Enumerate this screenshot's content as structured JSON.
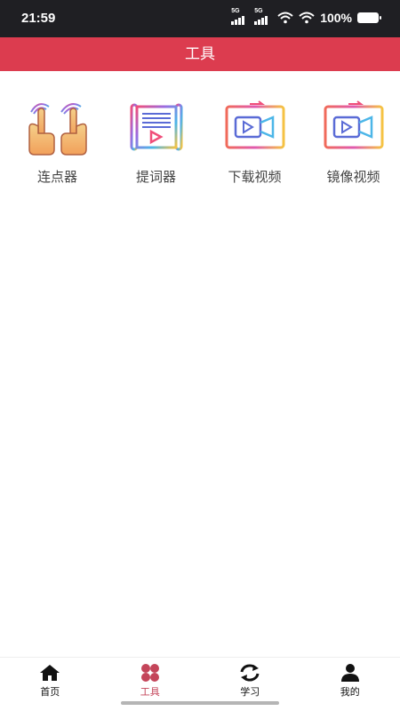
{
  "status_bar": {
    "time": "21:59",
    "network1": "5G",
    "network2": "5G",
    "battery": "100%"
  },
  "header": {
    "title": "工具"
  },
  "tools": [
    {
      "label": "连点器",
      "icon": "auto-clicker-hands-icon"
    },
    {
      "label": "提词器",
      "icon": "teleprompter-icon"
    },
    {
      "label": "下载视频",
      "icon": "download-video-icon"
    },
    {
      "label": "镜像视频",
      "icon": "mirror-video-icon"
    }
  ],
  "tabbar": {
    "items": [
      {
        "label": "首页",
        "icon": "home-icon"
      },
      {
        "label": "工具",
        "icon": "tools-grid-icon",
        "active": true
      },
      {
        "label": "学习",
        "icon": "refresh-cycle-icon"
      },
      {
        "label": "我的",
        "icon": "user-icon"
      }
    ],
    "active_color": "#c4455a"
  },
  "colors": {
    "header_bg": "#dc3c4f",
    "status_bg": "#1f1f23"
  }
}
